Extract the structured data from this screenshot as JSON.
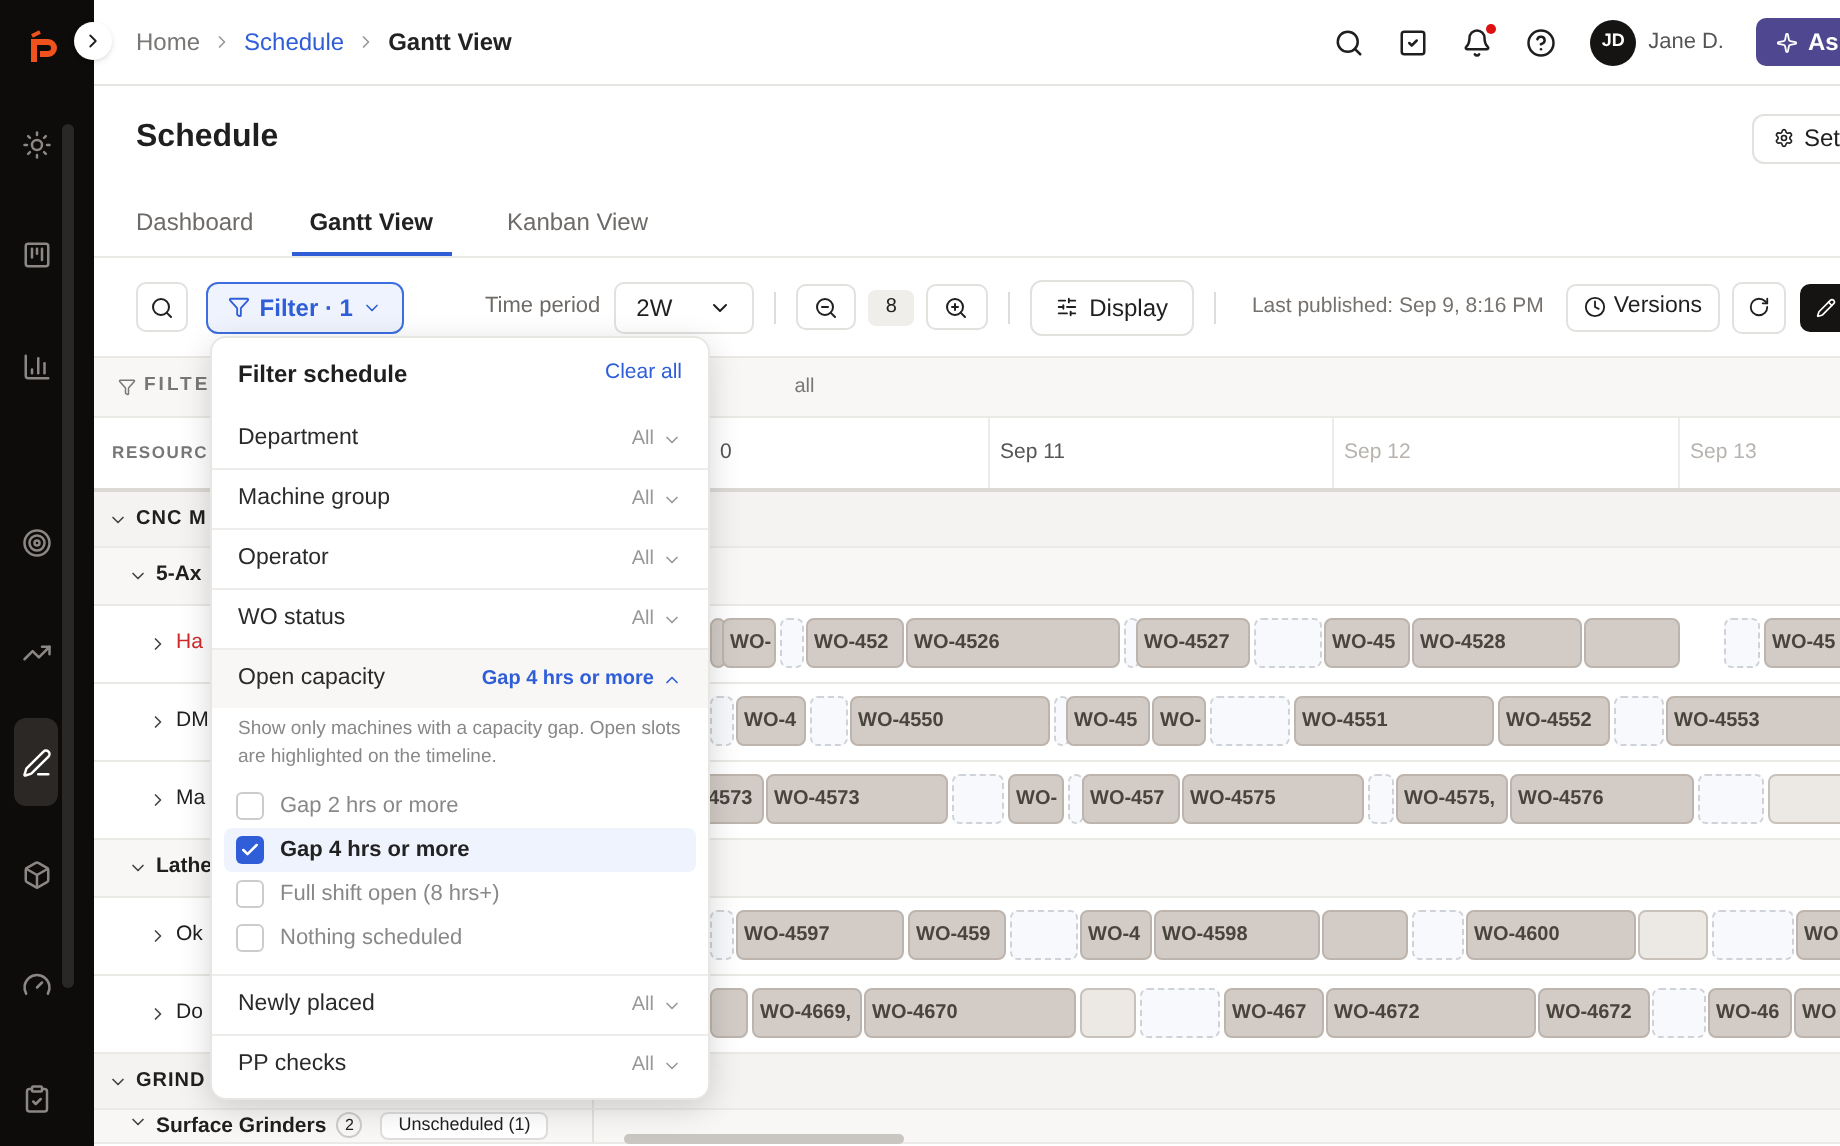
{
  "sidebar": {
    "items": [
      {
        "selected": false
      },
      {
        "selected": false
      },
      {
        "selected": false
      },
      {
        "selected": false
      },
      {
        "selected": false
      },
      {
        "selected": true
      },
      {
        "selected": false
      },
      {
        "selected": false
      },
      {
        "selected": false
      }
    ]
  },
  "breadcrumbs": [
    {
      "label": "Home",
      "kind": "plain"
    },
    {
      "label": "Schedule",
      "kind": "link"
    },
    {
      "label": "Gantt View",
      "kind": "current"
    }
  ],
  "user": {
    "initials": "JD",
    "name": "Jane D.",
    "notification": true
  },
  "ask_button": "As",
  "page_title": "Schedule",
  "settings_button": "Set",
  "tabs": [
    {
      "label": "Dashboard",
      "selected": false
    },
    {
      "label": "Gantt View",
      "selected": true
    },
    {
      "label": "Kanban View",
      "selected": false
    }
  ],
  "toolbar": {
    "filter": "Filter · 1",
    "time_period_label": "Time period",
    "time_period": "2W",
    "zoom_level": "8",
    "display": "Display",
    "last_published": "Last published: Sep 9, 8:16 PM",
    "versions": "Versions"
  },
  "filter_bar": {
    "label": "FILTE",
    "trailing": "all"
  },
  "resource_header": "RESOURC",
  "dates": [
    {
      "label": "0",
      "dimmed": false
    },
    {
      "label": "Sep 11",
      "dimmed": false
    },
    {
      "label": "Sep 12",
      "dimmed": true
    },
    {
      "label": "Sep 13",
      "dimmed": true
    }
  ],
  "rows": [
    {
      "kind": "group",
      "label": "CNC M",
      "expanded": true
    },
    {
      "kind": "subgroup",
      "label": "5-Ax",
      "expanded": true
    },
    {
      "kind": "machine",
      "label": "Ha",
      "alert": true,
      "expanded": false,
      "bars": [
        {
          "kind": "job"
        },
        {
          "kind": "job",
          "label": "WO-"
        },
        {
          "kind": "open"
        },
        {
          "kind": "job",
          "label": "WO-452"
        },
        {
          "kind": "job",
          "label": "WO-4526"
        },
        {
          "kind": "open"
        },
        {
          "kind": "job",
          "label": "WO-4527"
        },
        {
          "kind": "open"
        },
        {
          "kind": "job",
          "label": "WO-45"
        },
        {
          "kind": "job",
          "label": "WO-4528"
        },
        {
          "kind": "job"
        },
        {
          "kind": "open"
        },
        {
          "kind": "job",
          "label": "WO-45"
        }
      ]
    },
    {
      "kind": "machine",
      "label": "DM",
      "alert": false,
      "expanded": false,
      "bars": [
        {
          "kind": "open"
        },
        {
          "kind": "job",
          "label": "WO-4"
        },
        {
          "kind": "open"
        },
        {
          "kind": "job",
          "label": "WO-4550"
        },
        {
          "kind": "open"
        },
        {
          "kind": "job",
          "label": "WO-45"
        },
        {
          "kind": "job",
          "label": "WO-"
        },
        {
          "kind": "open"
        },
        {
          "kind": "job",
          "label": "WO-4551"
        },
        {
          "kind": "job",
          "label": "WO-4552"
        },
        {
          "kind": "open"
        },
        {
          "kind": "job",
          "label": "WO-4553"
        }
      ]
    },
    {
      "kind": "machine",
      "label": "Ma",
      "alert": false,
      "expanded": false,
      "bars": [
        {
          "kind": "job",
          "label": "4573"
        },
        {
          "kind": "job",
          "label": "WO-4573"
        },
        {
          "kind": "open"
        },
        {
          "kind": "job",
          "label": "WO-"
        },
        {
          "kind": "open"
        },
        {
          "kind": "job",
          "label": "WO-457"
        },
        {
          "kind": "job",
          "label": "WO-4575"
        },
        {
          "kind": "open"
        },
        {
          "kind": "job",
          "label": "WO-4575,"
        },
        {
          "kind": "job",
          "label": "WO-4576"
        },
        {
          "kind": "open"
        },
        {
          "kind": "idle"
        }
      ]
    },
    {
      "kind": "subgroup",
      "label": "Lathe",
      "expanded": true
    },
    {
      "kind": "machine",
      "label": "Ok",
      "alert": false,
      "expanded": false,
      "bars": [
        {
          "kind": "open"
        },
        {
          "kind": "job",
          "label": "WO-4597"
        },
        {
          "kind": "job",
          "label": "WO-459"
        },
        {
          "kind": "open"
        },
        {
          "kind": "job",
          "label": "WO-4"
        },
        {
          "kind": "job",
          "label": "WO-4598"
        },
        {
          "kind": "job"
        },
        {
          "kind": "open"
        },
        {
          "kind": "job",
          "label": "WO-4600"
        },
        {
          "kind": "idle"
        },
        {
          "kind": "open"
        },
        {
          "kind": "job",
          "label": "WO"
        }
      ]
    },
    {
      "kind": "machine",
      "label": "Do",
      "alert": false,
      "expanded": false,
      "bars": [
        {
          "kind": "job"
        },
        {
          "kind": "job",
          "label": "WO-4669,"
        },
        {
          "kind": "job",
          "label": "WO-4670"
        },
        {
          "kind": "idle"
        },
        {
          "kind": "open"
        },
        {
          "kind": "job",
          "label": "WO-467"
        },
        {
          "kind": "job",
          "label": "WO-4672"
        },
        {
          "kind": "job",
          "label": "WO-4672"
        },
        {
          "kind": "open"
        },
        {
          "kind": "job",
          "label": "WO-46"
        },
        {
          "kind": "job",
          "label": "WO"
        }
      ]
    },
    {
      "kind": "group",
      "label": "GRIND",
      "expanded": true
    },
    {
      "kind": "subgroup",
      "label": "Surface Grinders",
      "expanded": true,
      "count": "2",
      "badge": "Unscheduled (1)"
    }
  ],
  "filter_popup": {
    "title": "Filter schedule",
    "clear_all": "Clear all",
    "filters": [
      {
        "label": "Department",
        "value": "All",
        "active": false,
        "expanded": false
      },
      {
        "label": "Machine group",
        "value": "All",
        "active": false,
        "expanded": false
      },
      {
        "label": "Operator",
        "value": "All",
        "active": false,
        "expanded": false
      },
      {
        "label": "WO status",
        "value": "All",
        "active": false,
        "expanded": false
      },
      {
        "label": "Open capacity",
        "value": "Gap 4 hrs or more",
        "active": true,
        "expanded": true,
        "description": "Show only machines with a capacity gap. Open slots are highlighted on the timeline.",
        "options": [
          {
            "label": "Gap 2 hrs or more",
            "checked": false
          },
          {
            "label": "Gap 4 hrs or more",
            "checked": true
          },
          {
            "label": "Full shift open (8 hrs+)",
            "checked": false
          },
          {
            "label": "Nothing scheduled",
            "checked": false
          }
        ]
      },
      {
        "label": "Newly placed",
        "value": "All",
        "active": false,
        "expanded": false
      },
      {
        "label": "PP checks",
        "value": "All",
        "active": false,
        "expanded": false
      }
    ]
  }
}
